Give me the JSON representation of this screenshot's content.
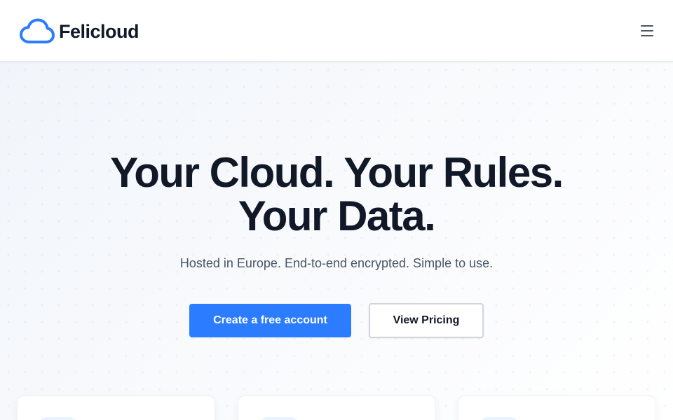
{
  "header": {
    "brand_name": "Felicloud",
    "logo_icon": "cloud-icon",
    "menu_icon": "hamburger-icon"
  },
  "hero": {
    "title_line1": "Your Cloud. Your Rules.",
    "title_line2": "Your Data.",
    "subtitle": "Hosted in Europe. End-to-end encrypted. Simple to use.",
    "primary_cta": "Create a free account",
    "secondary_cta": "View Pricing"
  },
  "colors": {
    "accent": "#2b7cff",
    "text": "#111827",
    "muted": "#4b5563"
  }
}
